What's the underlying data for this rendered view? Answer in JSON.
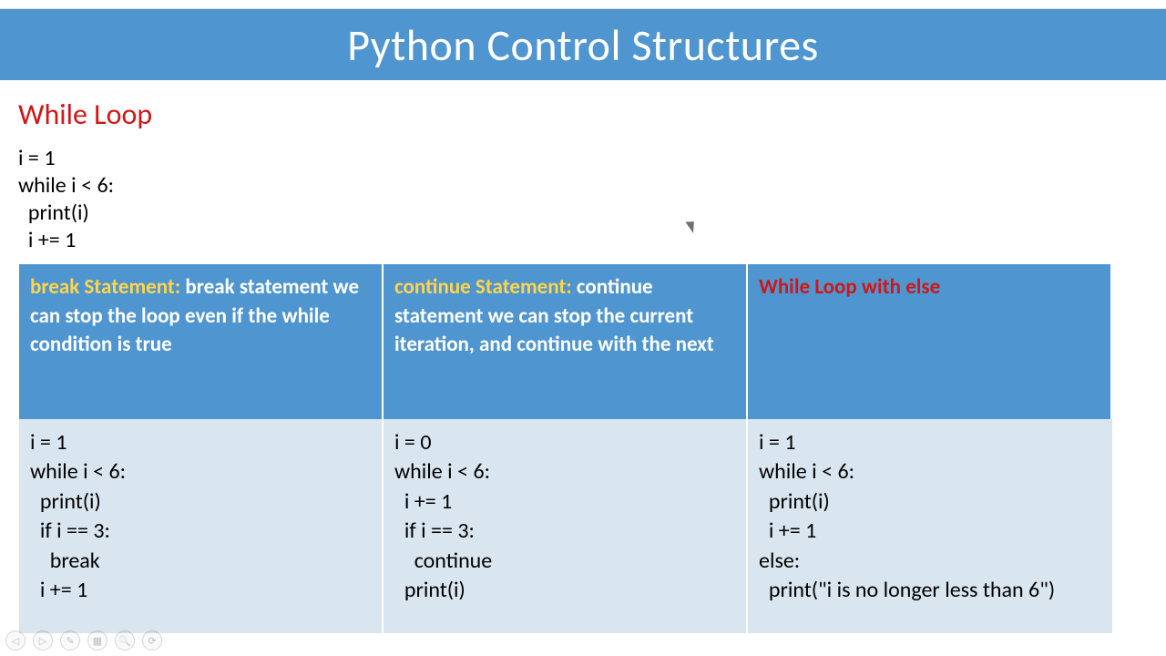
{
  "title": "Python Control Structures",
  "section_heading": "While Loop",
  "intro_code": "i = 1\nwhile i < 6:\n  print(i)\n  i += 1",
  "columns": [
    {
      "header_key": "break Statement:",
      "header_text": " break statement we can stop the loop even if the while condition is true",
      "header_style": "yellow",
      "code": "i = 1\nwhile i < 6:\n  print(i)\n  if i == 3:\n    break\n  i += 1"
    },
    {
      "header_key": "continue Statement:",
      "header_text": " continue statement we can stop the current iteration, and continue with the next",
      "header_style": "yellow",
      "code": "i = 0\nwhile i < 6:\n  i += 1\n  if i == 3:\n    continue\n  print(i)"
    },
    {
      "header_key": "While Loop with else",
      "header_text": "",
      "header_style": "red",
      "code": "i = 1\nwhile i < 6:\n  print(i)\n  i += 1\nelse:\n  print(\"i is no longer less than 6\")"
    }
  ],
  "controls": [
    "◁",
    "▷",
    "✎",
    "▦",
    "🔍",
    "⟳"
  ]
}
